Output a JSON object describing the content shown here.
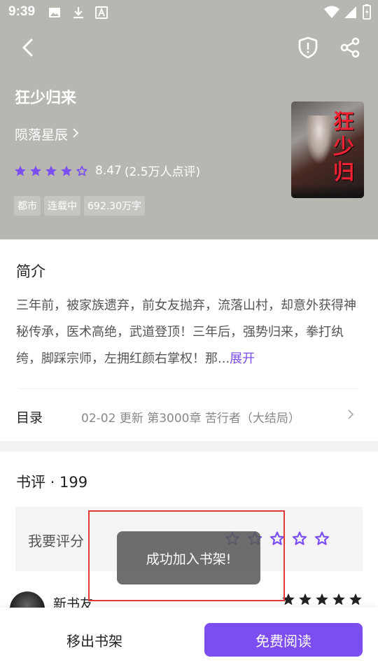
{
  "status_bar": {
    "time": "9:39"
  },
  "book": {
    "title": "狂少归来",
    "author": "陨落星辰",
    "rating": "8.47",
    "rating_count": "(2.5万人点评)",
    "stars_filled": 4.5,
    "tags": [
      "都市",
      "连载中",
      "692.30万字"
    ]
  },
  "intro": {
    "heading": "简介",
    "text": "三年前，被家族遗弃，前女友抛弃，流落山村，却意外获得神秘传承，医术高绝，武道登顶！三年后，强势归来，拳打纨绔，脚踩宗师，左拥红颜右掌权！那...",
    "expand_label": "展开"
  },
  "toc": {
    "label": "目录",
    "info": "02-02  更新  第3000章 苦行者（大结局）"
  },
  "reviews": {
    "heading": "书评 · 199",
    "rate_prompt": "我要评分",
    "first_reviewer": "新书友",
    "first_reviewer_stars": 5
  },
  "toast": {
    "message": "成功加入书架!"
  },
  "bottom": {
    "remove_label": "移出书架",
    "read_label": "免费阅读"
  },
  "colors": {
    "accent": "#7c4df0",
    "header_bg": "#b7b6b0",
    "highlight": "#e53935"
  },
  "icons": [
    "back-icon",
    "report-shield-icon",
    "share-icon",
    "chevron-right-icon",
    "star-icon",
    "image-icon",
    "download-icon",
    "font-icon",
    "wifi-icon",
    "signal-icon",
    "battery-icon"
  ]
}
